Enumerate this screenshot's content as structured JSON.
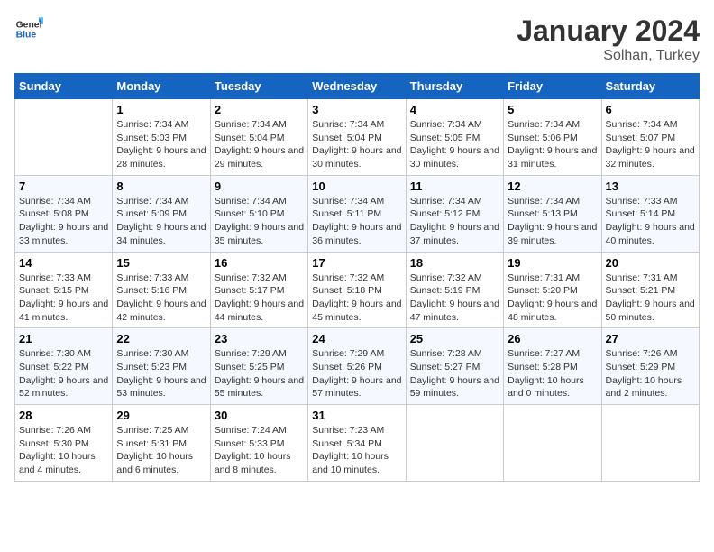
{
  "header": {
    "logo_general": "General",
    "logo_blue": "Blue",
    "title": "January 2024",
    "subtitle": "Solhan, Turkey"
  },
  "calendar": {
    "weekdays": [
      "Sunday",
      "Monday",
      "Tuesday",
      "Wednesday",
      "Thursday",
      "Friday",
      "Saturday"
    ],
    "weeks": [
      [
        {
          "day": "",
          "sunrise": "",
          "sunset": "",
          "daylight": ""
        },
        {
          "day": "1",
          "sunrise": "Sunrise: 7:34 AM",
          "sunset": "Sunset: 5:03 PM",
          "daylight": "Daylight: 9 hours and 28 minutes."
        },
        {
          "day": "2",
          "sunrise": "Sunrise: 7:34 AM",
          "sunset": "Sunset: 5:04 PM",
          "daylight": "Daylight: 9 hours and 29 minutes."
        },
        {
          "day": "3",
          "sunrise": "Sunrise: 7:34 AM",
          "sunset": "Sunset: 5:04 PM",
          "daylight": "Daylight: 9 hours and 30 minutes."
        },
        {
          "day": "4",
          "sunrise": "Sunrise: 7:34 AM",
          "sunset": "Sunset: 5:05 PM",
          "daylight": "Daylight: 9 hours and 30 minutes."
        },
        {
          "day": "5",
          "sunrise": "Sunrise: 7:34 AM",
          "sunset": "Sunset: 5:06 PM",
          "daylight": "Daylight: 9 hours and 31 minutes."
        },
        {
          "day": "6",
          "sunrise": "Sunrise: 7:34 AM",
          "sunset": "Sunset: 5:07 PM",
          "daylight": "Daylight: 9 hours and 32 minutes."
        }
      ],
      [
        {
          "day": "7",
          "sunrise": "Sunrise: 7:34 AM",
          "sunset": "Sunset: 5:08 PM",
          "daylight": "Daylight: 9 hours and 33 minutes."
        },
        {
          "day": "8",
          "sunrise": "Sunrise: 7:34 AM",
          "sunset": "Sunset: 5:09 PM",
          "daylight": "Daylight: 9 hours and 34 minutes."
        },
        {
          "day": "9",
          "sunrise": "Sunrise: 7:34 AM",
          "sunset": "Sunset: 5:10 PM",
          "daylight": "Daylight: 9 hours and 35 minutes."
        },
        {
          "day": "10",
          "sunrise": "Sunrise: 7:34 AM",
          "sunset": "Sunset: 5:11 PM",
          "daylight": "Daylight: 9 hours and 36 minutes."
        },
        {
          "day": "11",
          "sunrise": "Sunrise: 7:34 AM",
          "sunset": "Sunset: 5:12 PM",
          "daylight": "Daylight: 9 hours and 37 minutes."
        },
        {
          "day": "12",
          "sunrise": "Sunrise: 7:34 AM",
          "sunset": "Sunset: 5:13 PM",
          "daylight": "Daylight: 9 hours and 39 minutes."
        },
        {
          "day": "13",
          "sunrise": "Sunrise: 7:33 AM",
          "sunset": "Sunset: 5:14 PM",
          "daylight": "Daylight: 9 hours and 40 minutes."
        }
      ],
      [
        {
          "day": "14",
          "sunrise": "Sunrise: 7:33 AM",
          "sunset": "Sunset: 5:15 PM",
          "daylight": "Daylight: 9 hours and 41 minutes."
        },
        {
          "day": "15",
          "sunrise": "Sunrise: 7:33 AM",
          "sunset": "Sunset: 5:16 PM",
          "daylight": "Daylight: 9 hours and 42 minutes."
        },
        {
          "day": "16",
          "sunrise": "Sunrise: 7:32 AM",
          "sunset": "Sunset: 5:17 PM",
          "daylight": "Daylight: 9 hours and 44 minutes."
        },
        {
          "day": "17",
          "sunrise": "Sunrise: 7:32 AM",
          "sunset": "Sunset: 5:18 PM",
          "daylight": "Daylight: 9 hours and 45 minutes."
        },
        {
          "day": "18",
          "sunrise": "Sunrise: 7:32 AM",
          "sunset": "Sunset: 5:19 PM",
          "daylight": "Daylight: 9 hours and 47 minutes."
        },
        {
          "day": "19",
          "sunrise": "Sunrise: 7:31 AM",
          "sunset": "Sunset: 5:20 PM",
          "daylight": "Daylight: 9 hours and 48 minutes."
        },
        {
          "day": "20",
          "sunrise": "Sunrise: 7:31 AM",
          "sunset": "Sunset: 5:21 PM",
          "daylight": "Daylight: 9 hours and 50 minutes."
        }
      ],
      [
        {
          "day": "21",
          "sunrise": "Sunrise: 7:30 AM",
          "sunset": "Sunset: 5:22 PM",
          "daylight": "Daylight: 9 hours and 52 minutes."
        },
        {
          "day": "22",
          "sunrise": "Sunrise: 7:30 AM",
          "sunset": "Sunset: 5:23 PM",
          "daylight": "Daylight: 9 hours and 53 minutes."
        },
        {
          "day": "23",
          "sunrise": "Sunrise: 7:29 AM",
          "sunset": "Sunset: 5:25 PM",
          "daylight": "Daylight: 9 hours and 55 minutes."
        },
        {
          "day": "24",
          "sunrise": "Sunrise: 7:29 AM",
          "sunset": "Sunset: 5:26 PM",
          "daylight": "Daylight: 9 hours and 57 minutes."
        },
        {
          "day": "25",
          "sunrise": "Sunrise: 7:28 AM",
          "sunset": "Sunset: 5:27 PM",
          "daylight": "Daylight: 9 hours and 59 minutes."
        },
        {
          "day": "26",
          "sunrise": "Sunrise: 7:27 AM",
          "sunset": "Sunset: 5:28 PM",
          "daylight": "Daylight: 10 hours and 0 minutes."
        },
        {
          "day": "27",
          "sunrise": "Sunrise: 7:26 AM",
          "sunset": "Sunset: 5:29 PM",
          "daylight": "Daylight: 10 hours and 2 minutes."
        }
      ],
      [
        {
          "day": "28",
          "sunrise": "Sunrise: 7:26 AM",
          "sunset": "Sunset: 5:30 PM",
          "daylight": "Daylight: 10 hours and 4 minutes."
        },
        {
          "day": "29",
          "sunrise": "Sunrise: 7:25 AM",
          "sunset": "Sunset: 5:31 PM",
          "daylight": "Daylight: 10 hours and 6 minutes."
        },
        {
          "day": "30",
          "sunrise": "Sunrise: 7:24 AM",
          "sunset": "Sunset: 5:33 PM",
          "daylight": "Daylight: 10 hours and 8 minutes."
        },
        {
          "day": "31",
          "sunrise": "Sunrise: 7:23 AM",
          "sunset": "Sunset: 5:34 PM",
          "daylight": "Daylight: 10 hours and 10 minutes."
        },
        {
          "day": "",
          "sunrise": "",
          "sunset": "",
          "daylight": ""
        },
        {
          "day": "",
          "sunrise": "",
          "sunset": "",
          "daylight": ""
        },
        {
          "day": "",
          "sunrise": "",
          "sunset": "",
          "daylight": ""
        }
      ]
    ]
  }
}
